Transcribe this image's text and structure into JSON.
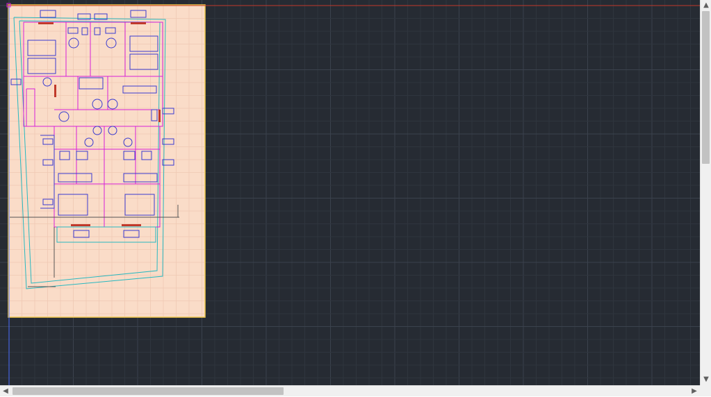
{
  "app": {
    "canvas_bg": "#262b33",
    "grid_minor": "#2f353e",
    "grid_major": "#3b424d",
    "sheet_color": "#fadcc8",
    "sheet_border": "#f2c94c",
    "plan_magenta": "#d81fd8",
    "plan_blue": "#3a3ad0",
    "plan_cyan": "#28b8c0",
    "ucs_red": "#c0392b",
    "ucs_blue": "#4a6cff"
  },
  "scrollbars": {
    "vertical": {
      "up_icon": "▲",
      "down_icon": "▼",
      "thumb_fraction_start": 0.0,
      "thumb_fraction_size": 0.42
    },
    "horizontal": {
      "left_icon": "◀",
      "right_icon": "▶",
      "thumb_fraction_start": 0.0,
      "thumb_fraction_size": 0.4
    }
  }
}
